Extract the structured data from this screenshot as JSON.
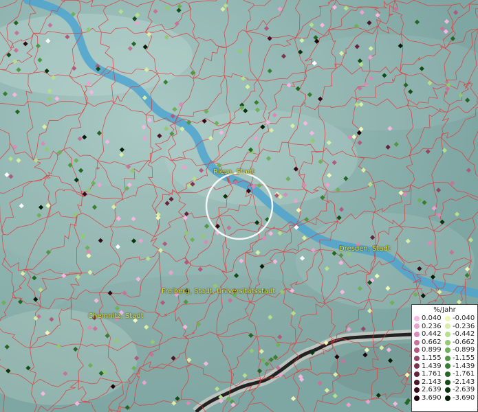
{
  "map": {
    "places": [
      {
        "id": "riesa",
        "label": "Riesa, Stadt"
      },
      {
        "id": "dresden",
        "label": "Dresden, Stadt"
      },
      {
        "id": "freiberg",
        "label": "Freiberg, Stadt, Universitätsstadt"
      },
      {
        "id": "chemnitz",
        "label": "Chemnitz, Stadt"
      }
    ]
  },
  "legend": {
    "title": "%/Jahr",
    "positive": [
      {
        "label": "0.040",
        "color": "#f4b8e0"
      },
      {
        "label": "0.236",
        "color": "#eaa3cf"
      },
      {
        "label": "0.442",
        "color": "#d98bb5"
      },
      {
        "label": "0.662",
        "color": "#c47498"
      },
      {
        "label": "0.899",
        "color": "#ad5c7e"
      },
      {
        "label": "1.155",
        "color": "#944765"
      },
      {
        "label": "1.439",
        "color": "#7d344f"
      },
      {
        "label": "1.761",
        "color": "#66243c"
      },
      {
        "label": "2.143",
        "color": "#4d1629"
      },
      {
        "label": "2.639",
        "color": "#360b19"
      },
      {
        "label": "3.690",
        "color": "#1c030b"
      }
    ],
    "negative": [
      {
        "label": "-0.040",
        "color": "#eef7b8"
      },
      {
        "label": "-0.236",
        "color": "#d6eea6"
      },
      {
        "label": "-0.442",
        "color": "#b5df8c"
      },
      {
        "label": "-0.662",
        "color": "#92c973"
      },
      {
        "label": "-0.899",
        "color": "#6eb05a"
      },
      {
        "label": "-1.155",
        "color": "#4f9744"
      },
      {
        "label": "-1.439",
        "color": "#377f33"
      },
      {
        "label": "-1.761",
        "color": "#246625"
      },
      {
        "label": "-2.143",
        "color": "#154d18"
      },
      {
        "label": "-2.639",
        "color": "#0a350d"
      },
      {
        "label": "-3.690",
        "color": "#031c05"
      }
    ]
  }
}
